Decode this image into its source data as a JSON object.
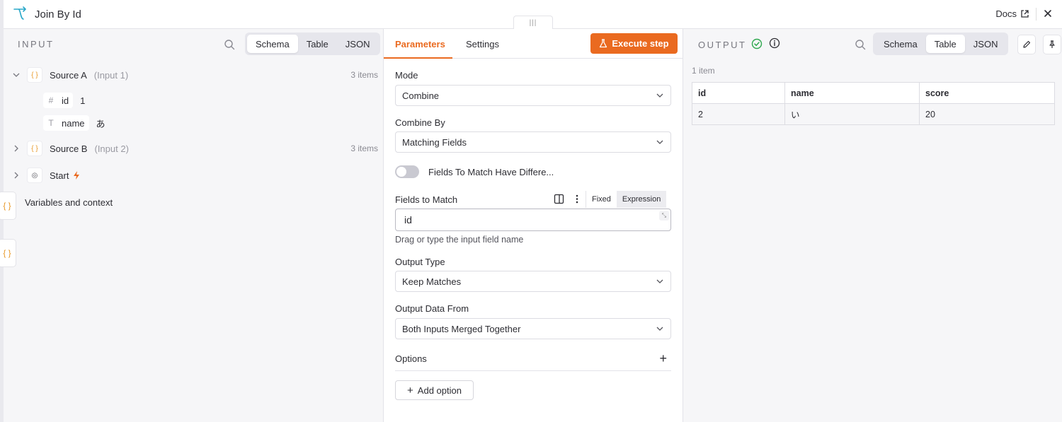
{
  "window": {
    "title": "Join By Id",
    "docs_label": "Docs"
  },
  "input": {
    "label": "INPUT",
    "tabs": [
      "Schema",
      "Table",
      "JSON"
    ],
    "active_tab": "Schema",
    "tree": {
      "source_a": {
        "name": "Source A",
        "sub": "(Input 1)",
        "count": "3 items"
      },
      "fields": [
        {
          "type_glyph": "#",
          "name": "id",
          "value": "1"
        },
        {
          "type_glyph": "T",
          "name": "name",
          "value": "あ"
        }
      ],
      "source_b": {
        "name": "Source B",
        "sub": "(Input 2)",
        "count": "3 items"
      },
      "start": {
        "name": "Start"
      },
      "variables": "Variables and context"
    }
  },
  "params": {
    "tabs": [
      "Parameters",
      "Settings"
    ],
    "active_tab": "Parameters",
    "execute_label": "Execute step",
    "mode": {
      "label": "Mode",
      "value": "Combine"
    },
    "combine_by": {
      "label": "Combine By",
      "value": "Matching Fields"
    },
    "toggle_label": "Fields To Match Have Differe...",
    "fields_to_match": {
      "label": "Fields to Match",
      "fixed_label": "Fixed",
      "expression_label": "Expression",
      "value": "id",
      "hint": "Drag or type the input field name"
    },
    "output_type": {
      "label": "Output Type",
      "value": "Keep Matches"
    },
    "output_data_from": {
      "label": "Output Data From",
      "value": "Both Inputs Merged Together"
    },
    "options_label": "Options",
    "add_option_label": "Add option"
  },
  "output": {
    "label": "OUTPUT",
    "tabs": [
      "Schema",
      "Table",
      "JSON"
    ],
    "active_tab": "Table",
    "items_count": "1 item",
    "columns": [
      "id",
      "name",
      "score"
    ],
    "rows": [
      [
        "2",
        "い",
        "20"
      ]
    ]
  },
  "colors": {
    "accent": "#ea6a20",
    "success": "#2fa84f",
    "object_badge": "#e89a2c"
  }
}
